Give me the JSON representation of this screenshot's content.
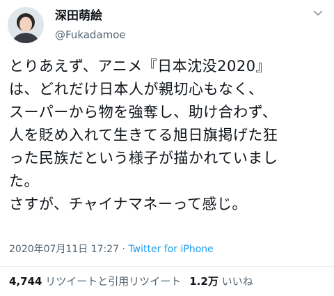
{
  "author": {
    "display_name": "深田萌絵",
    "handle": "@Fukadamoe",
    "avatar_icon": "user-avatar-photo"
  },
  "header": {
    "more_icon": "chevron-down-icon"
  },
  "tweet": {
    "text": "とりあえず、アニメ『日本沈没2020』\nは、どれだけ日本人が親切心もなく、\nスーパーから物を強奪し、助け合わず、\n人を貶め入れて生きてる旭日旗掲げた狂\nった民族だという様子が描かれていまし\nた。\nさすが、チャイナマネーって感じ。",
    "datetime": "2020年07月11日 17:27",
    "separator": " · ",
    "source": "Twitter for iPhone"
  },
  "stats": {
    "retweets_count": "4,744",
    "retweets_label": "リツイートと引用リツイート",
    "likes_count": "1.2万",
    "likes_label": "いいね"
  },
  "colors": {
    "text": "#0f1419",
    "secondary": "#536471",
    "link": "#1d9bf0",
    "divider": "#e6ecf0"
  }
}
